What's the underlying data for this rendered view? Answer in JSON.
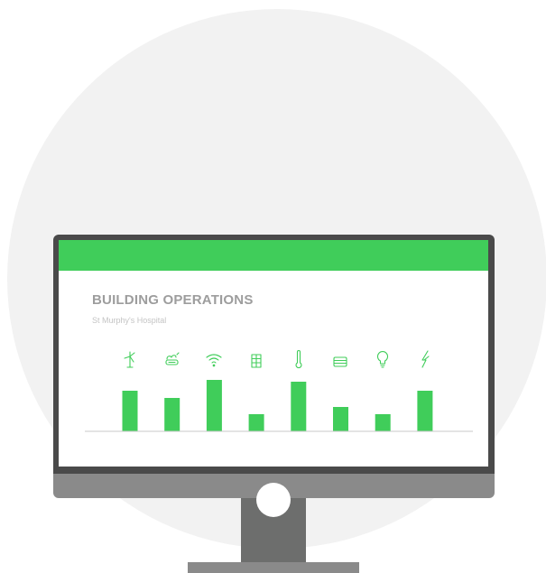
{
  "dashboard": {
    "title": "BUILDING OPERATIONS",
    "subtitle": "St Murphy's Hospital"
  },
  "colors": {
    "accent": "#40cd5a",
    "frame": "#4a4a4a",
    "stand": "#6d6e6d",
    "background_circle": "#f2f2f2"
  },
  "chart_data": {
    "type": "bar",
    "categories": [
      "wind-turbine-icon",
      "ventilation-icon",
      "wifi-icon",
      "building-icon",
      "thermometer-icon",
      "radiator-icon",
      "lightbulb-icon",
      "power-icon"
    ],
    "values": [
      45,
      37,
      57,
      19,
      55,
      27,
      19,
      45
    ],
    "ylim": [
      0,
      60
    ],
    "grid": false,
    "title": "",
    "xlabel": "",
    "ylabel": ""
  }
}
